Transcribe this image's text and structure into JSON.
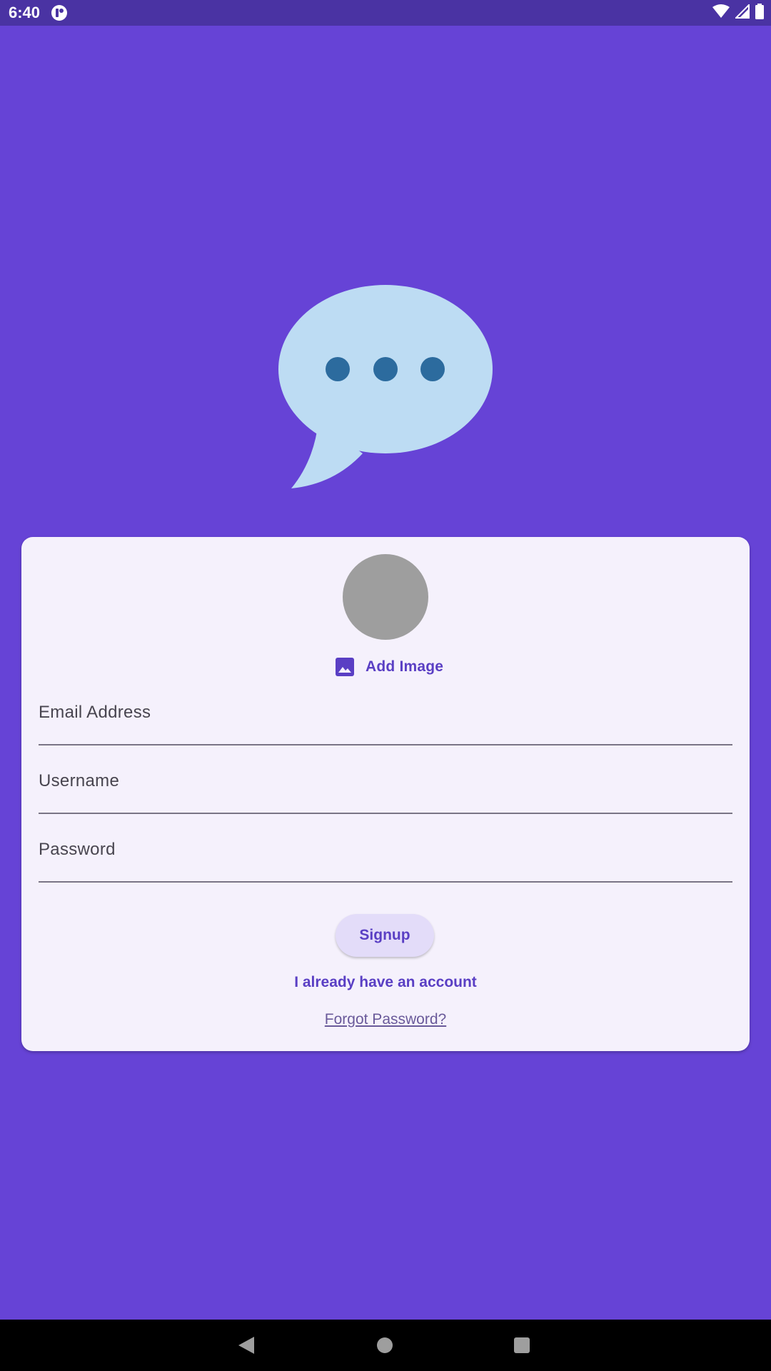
{
  "status_bar": {
    "time": "6:40",
    "icons": [
      "app-notification-icon",
      "wifi-icon",
      "cell-signal-icon",
      "battery-icon"
    ]
  },
  "logo": {
    "icon": "chat-bubble-icon",
    "bubble_color": "#bddcf3",
    "dot_color": "#2c6b9e"
  },
  "card": {
    "avatar_color": "#9e9e9e",
    "add_image": {
      "icon": "image-icon",
      "label": "Add Image"
    },
    "fields": {
      "email": {
        "label": "Email Address",
        "value": ""
      },
      "username": {
        "label": "Username",
        "value": ""
      },
      "password": {
        "label": "Password",
        "value": ""
      }
    },
    "signup_label": "Signup",
    "have_account_label": "I already have an account",
    "forgot_password_label": "Forgot Password?"
  },
  "nav_bar": {
    "icons": [
      "back-icon",
      "home-icon",
      "recents-icon"
    ]
  },
  "colors": {
    "background": "#6643d6",
    "status_bar": "#4a33a3",
    "card": "#f5f1fc",
    "accent": "#5a3fc4",
    "button_bg": "#e3dcf9"
  }
}
